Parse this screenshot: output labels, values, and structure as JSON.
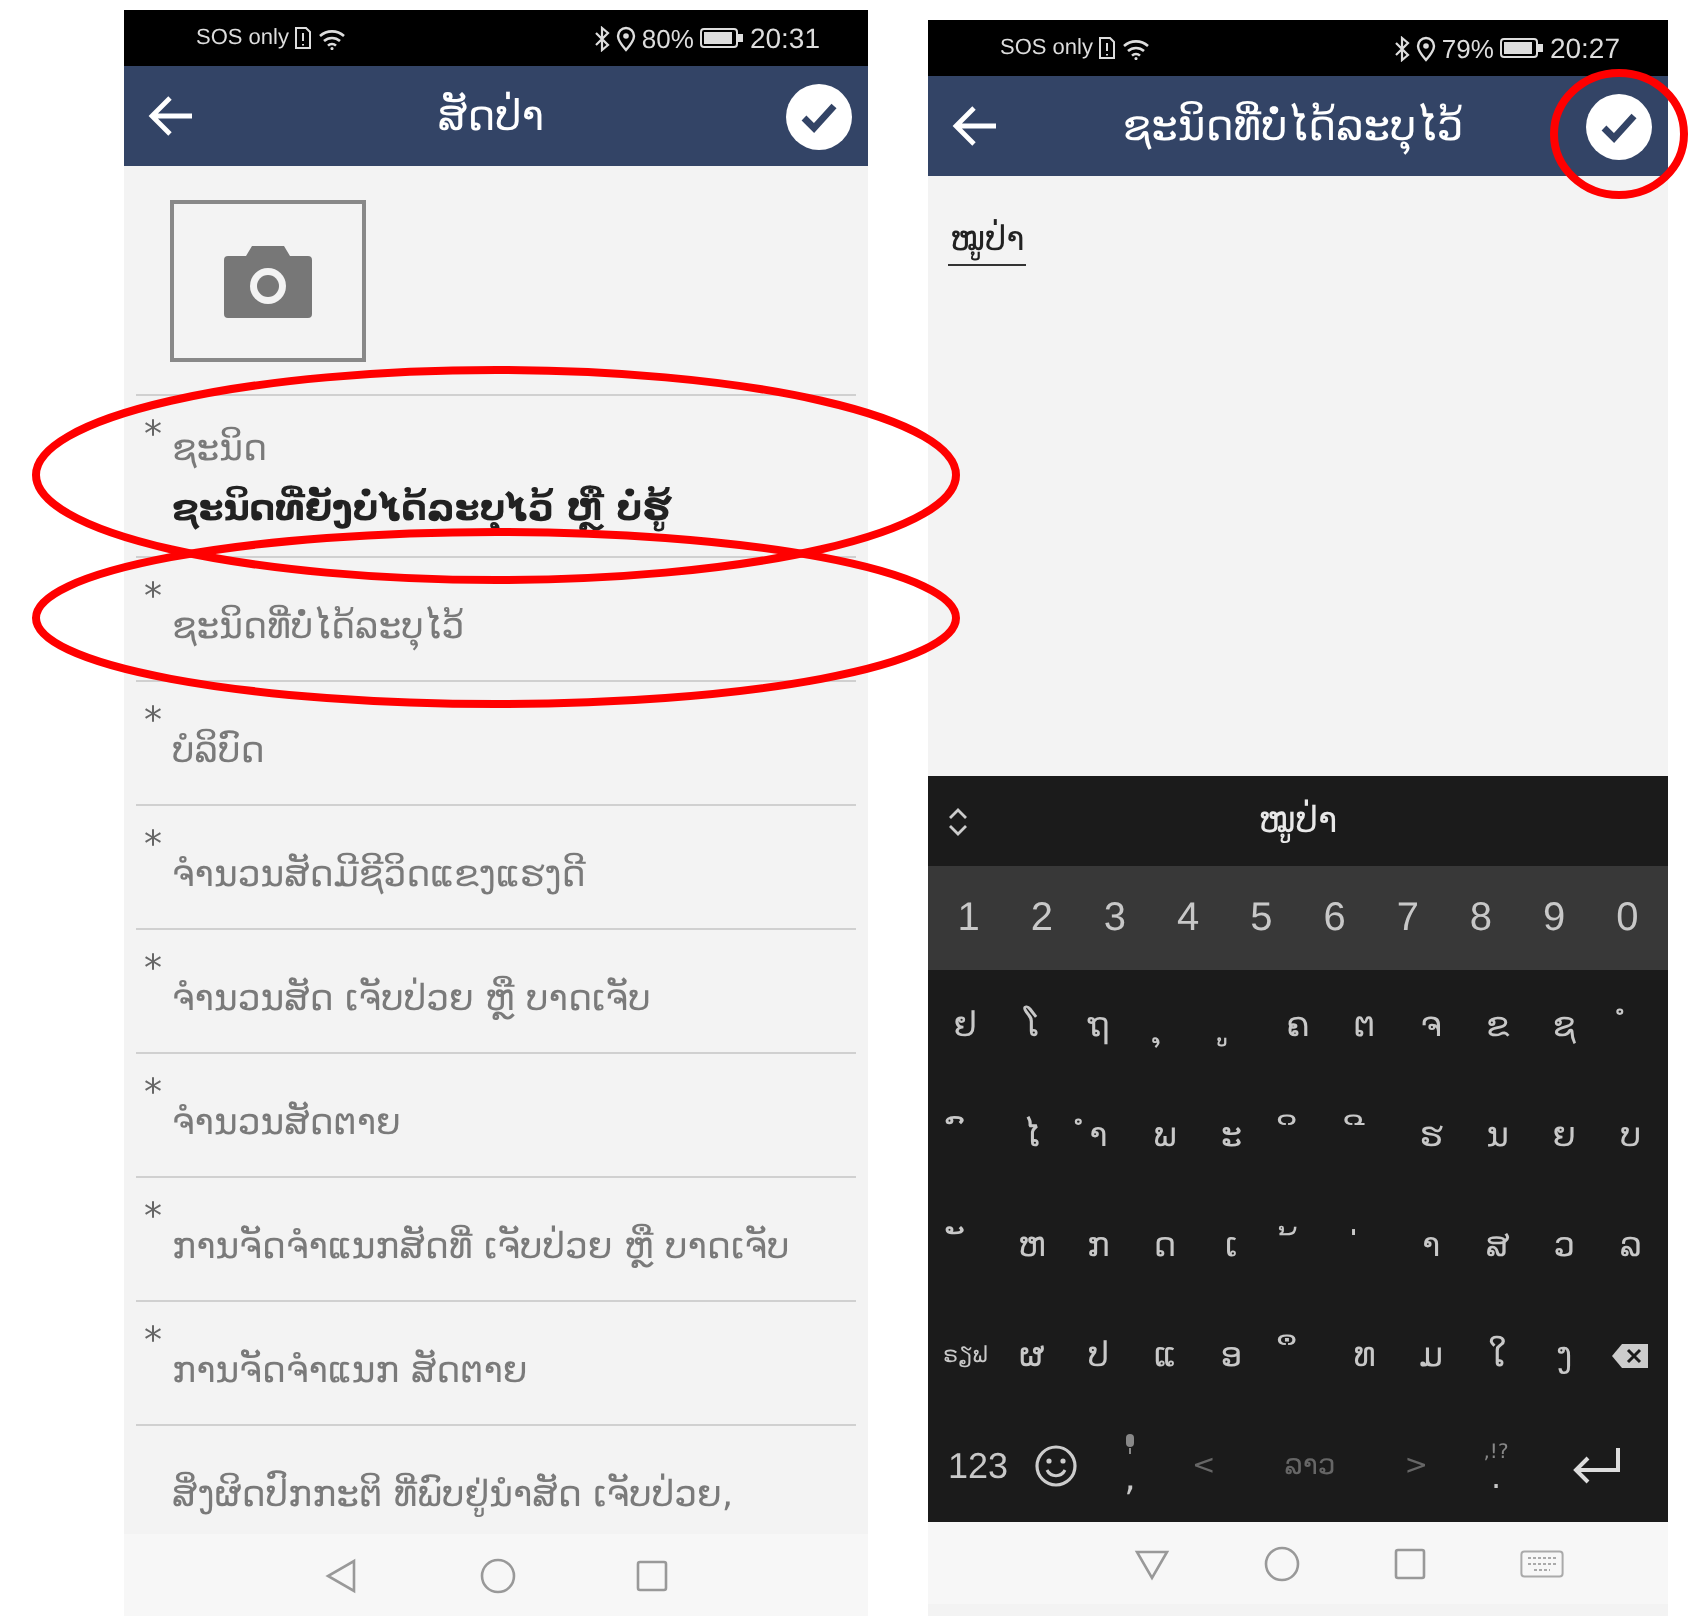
{
  "left_screen": {
    "status_bar": {
      "carrier": "SOS only",
      "battery": "80%",
      "time": "20:31"
    },
    "app_bar": {
      "title": "ສັດປ່າ"
    },
    "fields": [
      {
        "mark": "*",
        "label": "ຊະນິດ",
        "value": "ຊະນິດທີ່ຍັງບໍ່ໄດ້ລະບຸໄວ້ ຫຼື ບໍ່ຮູ້",
        "circled": true
      },
      {
        "mark": "*",
        "label": "ຊະນິດທີ່ບໍ່ໄດ້ລະບຸໄວ້",
        "circled": true
      },
      {
        "mark": "*",
        "label": "ບໍລິບົດ",
        "circled": false
      },
      {
        "mark": "*",
        "label": "ຈຳນວນສັດມີຊີວິດແຂງແຮງດີ",
        "circled": false
      },
      {
        "mark": "*",
        "label": "ຈຳນວນສັດ ເຈັບປ່ວຍ ຫຼື ບາດເຈັບ",
        "circled": false
      },
      {
        "mark": "*",
        "label": "ຈຳນວນສັດຕາຍ",
        "circled": false
      },
      {
        "mark": "*",
        "label": "ການຈັດຈຳແນກສັດທີ່ ເຈັບປ່ວຍ ຫຼື ບາດເຈັບ",
        "circled": false
      },
      {
        "mark": "*",
        "label": "ການຈັດຈຳແນກ ສັດຕາຍ",
        "circled": false
      },
      {
        "label": "ສິ່ງຜິດປົກກະຕິ ທີ່ພົບຢູ່ນຳສັດ ເຈັບປ່ວຍ,",
        "circled": false
      }
    ]
  },
  "right_screen": {
    "status_bar": {
      "carrier": "SOS only",
      "battery": "79%",
      "time": "20:27"
    },
    "app_bar": {
      "title": "ຊະນິດທີ່ບໍ່ໄດ້ລະບຸໄວ້",
      "confirm_circled": true
    },
    "text_input": {
      "value": "ໝູປ່າ"
    },
    "keyboard": {
      "suggestion": "ໝູປ່າ",
      "number_row": [
        "1",
        "2",
        "3",
        "4",
        "5",
        "6",
        "7",
        "8",
        "9",
        "0"
      ],
      "letter_rows": [
        [
          "ຢ",
          "ໂ",
          "ຖ",
          "ຸ",
          "ູ",
          "ຄ",
          "ຕ",
          "ຈ",
          "ຂ",
          "ຊ",
          "ໍ"
        ],
        [
          "ົ",
          "ໄ",
          "ຳ",
          "ພ",
          "ະ",
          "ິ",
          "ີ",
          "ຮ",
          "ນ",
          "ຍ",
          "ບ"
        ],
        [
          "ັ",
          "ຫ",
          "ກ",
          "ດ",
          "ເ",
          "້",
          "່",
          "າ",
          "ສ",
          "ວ",
          "ລ"
        ],
        [
          "ຜ",
          "ປ",
          "ແ",
          "ອ",
          "ຶ",
          "ທ",
          "ມ",
          "ໃ",
          "ງ"
        ]
      ],
      "shift_key": "ຣຽຟ",
      "bottom_row": {
        "symbols_key": "123",
        "comma_key": ",",
        "space_left": "<",
        "space_key": "ລາວ",
        "space_right": ">",
        "period_hint": ",!?",
        "period_key": "."
      }
    }
  }
}
